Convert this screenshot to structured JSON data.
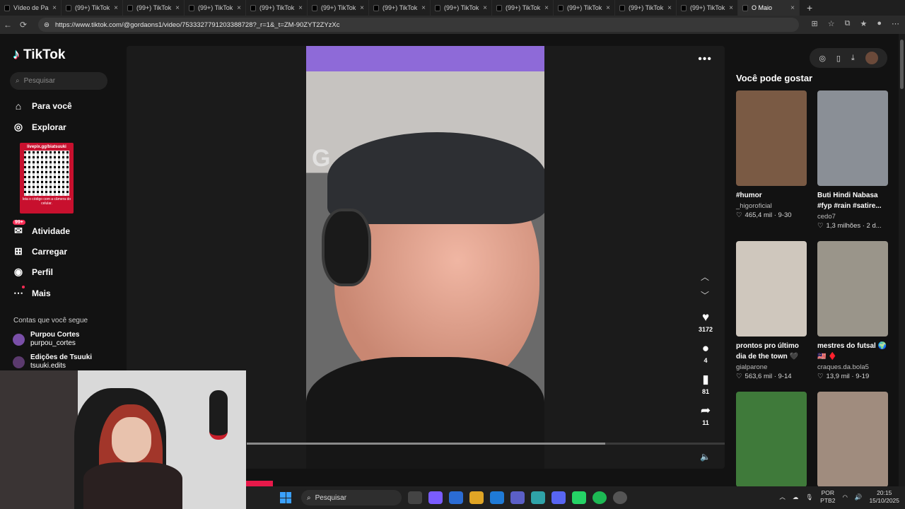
{
  "browser": {
    "tabs": [
      {
        "label": "Vídeo de Pa..."
      },
      {
        "label": "(99+) TikTok"
      },
      {
        "label": "(99+) TikTok"
      },
      {
        "label": "(99+) TikTok"
      },
      {
        "label": "(99+) TikTok"
      },
      {
        "label": "(99+) TikTok"
      },
      {
        "label": "(99+) TikTok"
      },
      {
        "label": "(99+) TikTok"
      },
      {
        "label": "(99+) TikTok"
      },
      {
        "label": "(99+) TikTok"
      },
      {
        "label": "(99+) TikTok"
      },
      {
        "label": "(99+) TikTok"
      },
      {
        "label": "O Maio"
      }
    ],
    "url": "https://www.tiktok.com/@gordaons1/video/7533327791203388728?_r=1&_t=ZM-90ZYT2ZYzXc"
  },
  "sidebar": {
    "logo": "TikTok",
    "search_placeholder": "Pesquisar",
    "items": [
      {
        "label": "Para você",
        "icon": "home-icon"
      },
      {
        "label": "Explorar",
        "icon": "compass-icon"
      },
      {
        "label": "Atividade",
        "icon": "inbox-icon",
        "badge": "99+"
      },
      {
        "label": "Carregar",
        "icon": "upload-icon"
      },
      {
        "label": "Perfil",
        "icon": "avatar-icon"
      },
      {
        "label": "Mais",
        "icon": "more-icon"
      }
    ],
    "following_title": "Contas que você segue",
    "following": [
      {
        "name": "Purpou Cortes",
        "handle": "purpou_cortes"
      },
      {
        "name": "Edições de Tsuuki",
        "handle": "tsuuki.edits"
      }
    ],
    "qr": {
      "top": "livepix.gg/biatsuuki",
      "bottom": "leia o código com a câmera do celular."
    }
  },
  "video": {
    "overlay_text": "G",
    "likes": "3172",
    "comments": "4",
    "saves": "81",
    "shares": "11",
    "progress": 0.75
  },
  "recommendations": {
    "title": "Você pode gostar",
    "cards": [
      {
        "title": "#humor",
        "user": "_higoroficial",
        "stats": "465,4 mil · 9-30",
        "thumb_color": "#7a5a44"
      },
      {
        "title": "Buti Hindi Nabasa #fyp #rain #satire...",
        "user": "cedo7",
        "stats": "1,3 milhões · 2 d...",
        "thumb_color": "#8a8f96"
      },
      {
        "title": "prontos pro último dia de the town 🖤",
        "user": "gialparone",
        "stats": "563,6 mil · 9-14",
        "thumb_color": "#cfc7bd"
      },
      {
        "title": "mestres do futsal 🌍 🇲🇾 ♦️",
        "user": "craques.da.bola5",
        "stats": "13,9 mil · 9-19",
        "thumb_color": "#9a958a"
      },
      {
        "title": "",
        "user": "",
        "stats": "",
        "thumb_color": "#3f7a3a"
      },
      {
        "title": "",
        "user": "",
        "stats": "",
        "thumb_color": "#a08c7e"
      }
    ]
  },
  "taskbar": {
    "search": "Pesquisar",
    "lang": "POR",
    "layout": "PTB2",
    "time": "20:15",
    "date": "15/10/2025"
  }
}
